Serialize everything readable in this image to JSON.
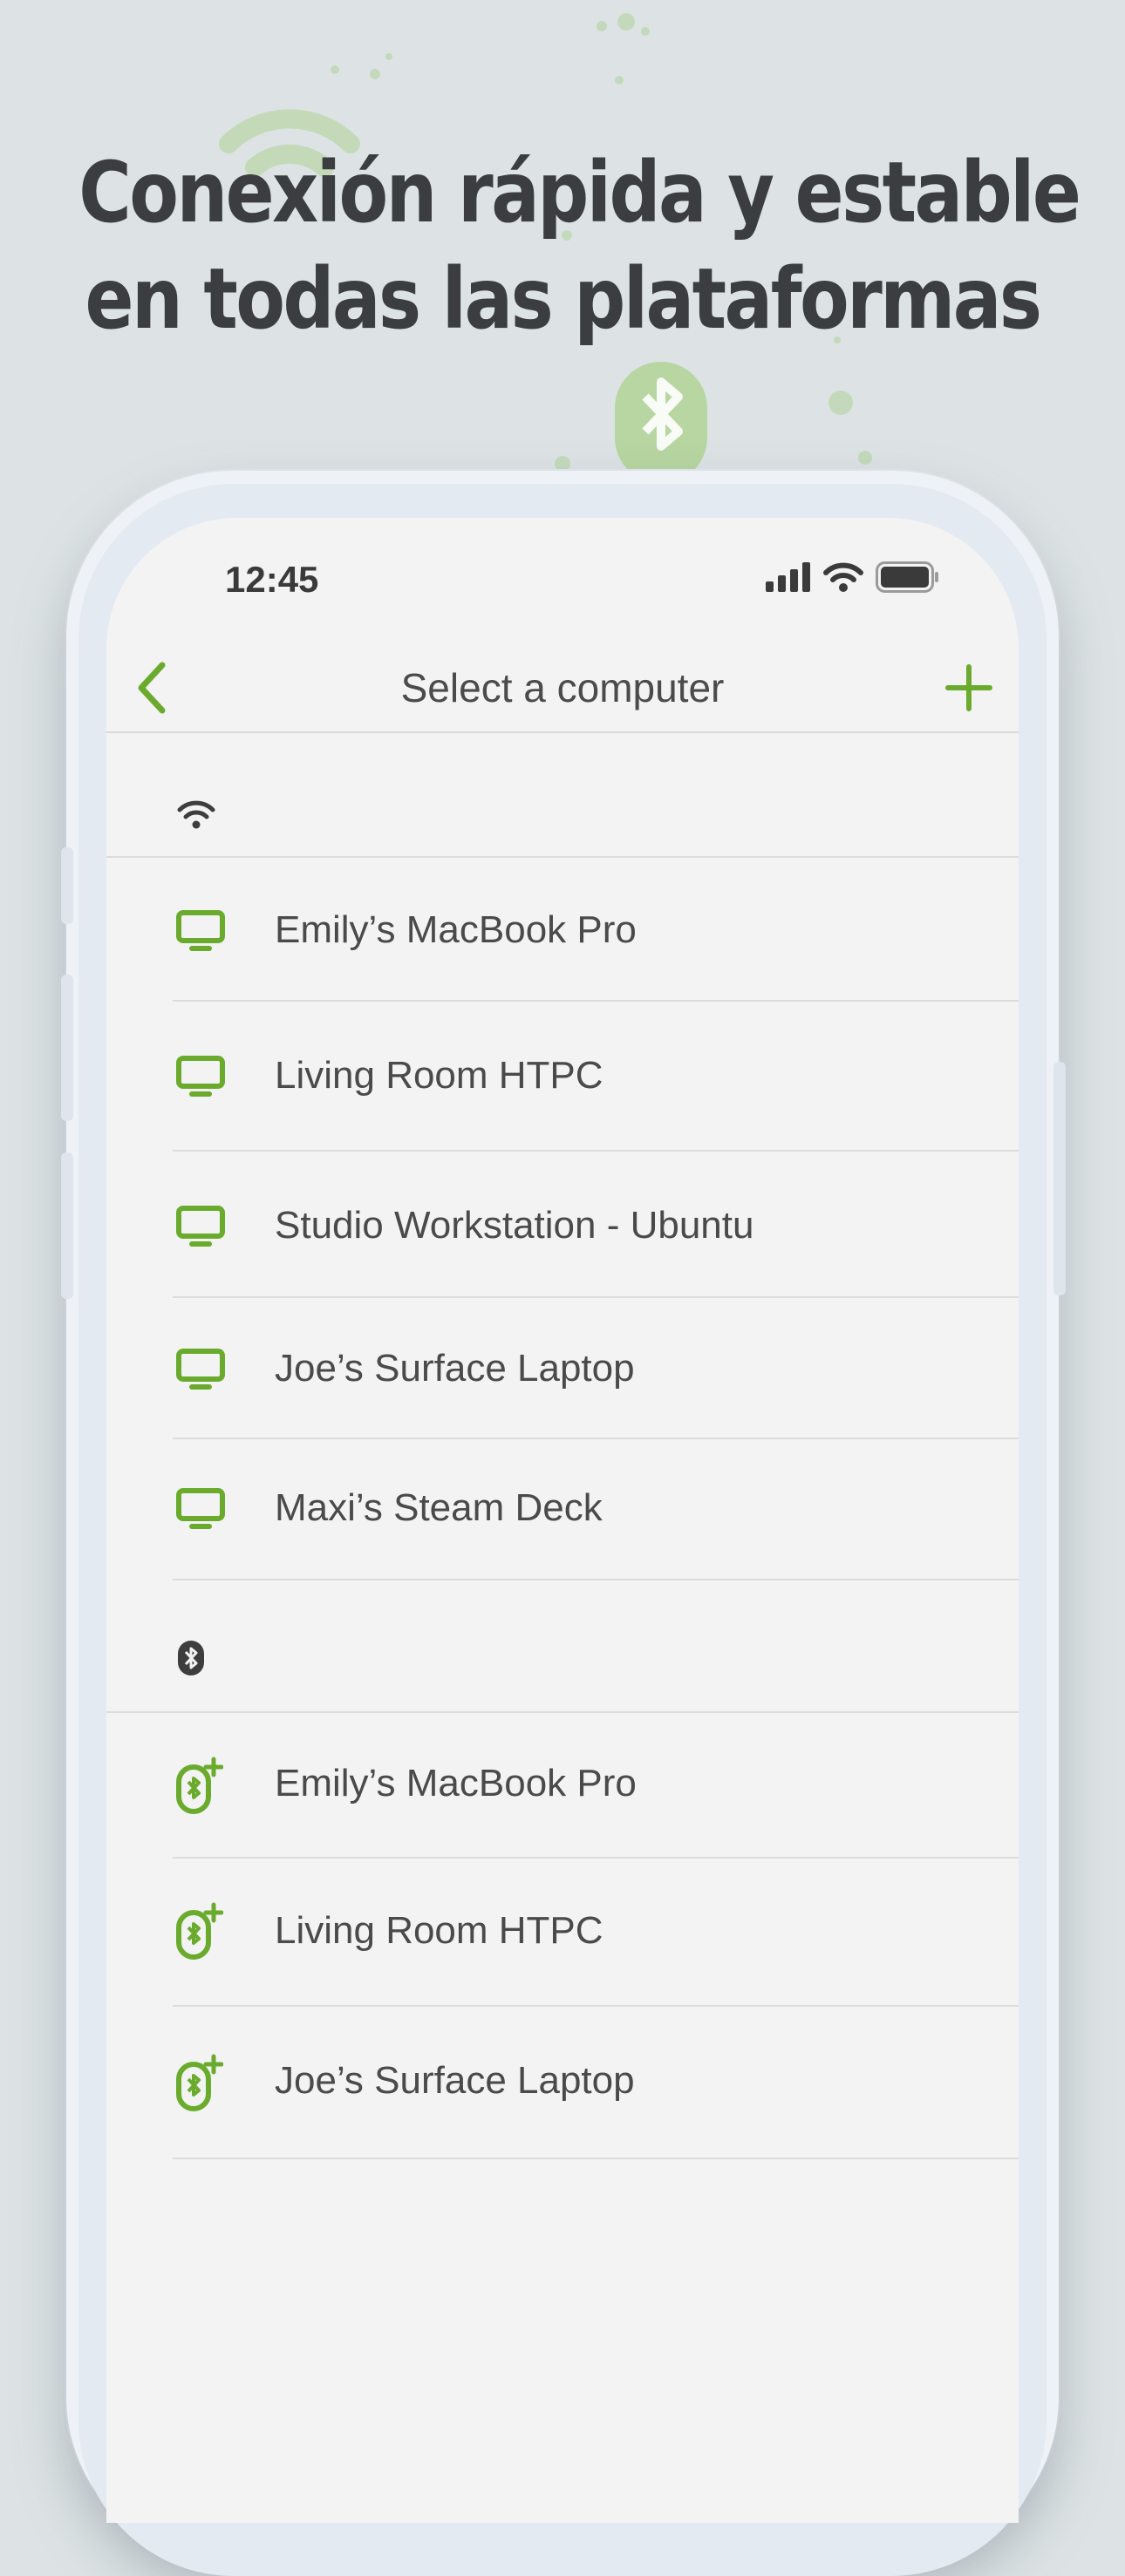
{
  "headline": {
    "line1": "Conexión rápida y estable",
    "line2": "en todas las plataformas"
  },
  "colors": {
    "accent": "#6aab2e",
    "text": "#4a4a4a",
    "headline": "#3b3d40"
  },
  "status_bar": {
    "time": "12:45",
    "icons": [
      "signal-icon",
      "wifi-icon",
      "battery-icon"
    ]
  },
  "nav": {
    "back_icon": "chevron-left-icon",
    "title": "Select a computer",
    "add_icon": "plus-icon"
  },
  "sections": {
    "wifi": {
      "icon": "wifi-icon",
      "items": [
        {
          "label": "Emily’s MacBook Pro",
          "icon": "monitor-icon"
        },
        {
          "label": "Living Room HTPC",
          "icon": "monitor-icon"
        },
        {
          "label": "Studio Workstation - Ubuntu",
          "icon": "monitor-icon"
        },
        {
          "label": "Joe’s Surface Laptop",
          "icon": "monitor-icon"
        },
        {
          "label": "Maxi’s Steam Deck",
          "icon": "monitor-icon"
        }
      ]
    },
    "bluetooth": {
      "icon": "bluetooth-icon",
      "items": [
        {
          "label": "Emily’s MacBook Pro",
          "icon": "bluetooth-add-icon"
        },
        {
          "label": "Living Room HTPC",
          "icon": "bluetooth-add-icon"
        },
        {
          "label": "Joe’s Surface Laptop",
          "icon": "bluetooth-add-icon"
        }
      ]
    }
  }
}
